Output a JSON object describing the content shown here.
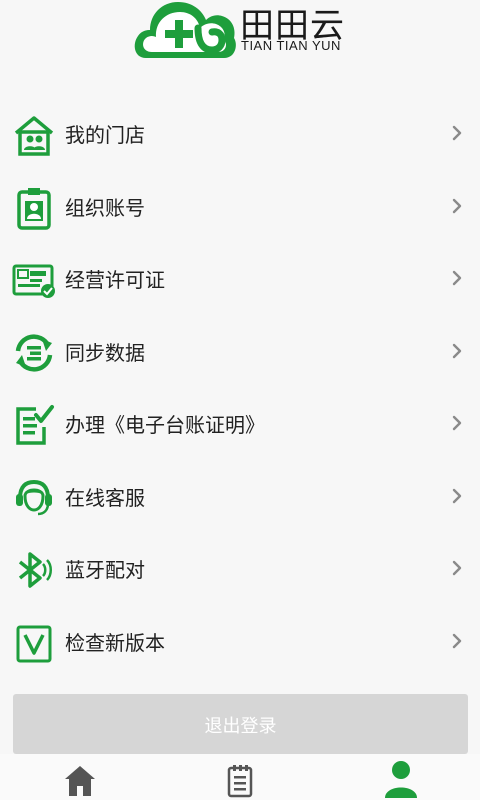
{
  "brand": {
    "name_cn": "田田云",
    "name_en": "TIAN TIAN YUN",
    "accent": "#1e9e3c"
  },
  "menu": {
    "items": [
      {
        "label": "我的门店",
        "icon": "store-icon"
      },
      {
        "label": "组织账号",
        "icon": "id-badge-icon"
      },
      {
        "label": "经营许可证",
        "icon": "license-icon"
      },
      {
        "label": "同步数据",
        "icon": "sync-icon"
      },
      {
        "label": "办理《电子台账证明》",
        "icon": "document-check-icon"
      },
      {
        "label": "在线客服",
        "icon": "headset-icon"
      },
      {
        "label": "蓝牙配对",
        "icon": "bluetooth-icon"
      },
      {
        "label": "检查新版本",
        "icon": "version-icon"
      }
    ]
  },
  "logout": {
    "label": "退出登录"
  },
  "tabbar": {
    "tabs": [
      {
        "icon": "home-icon",
        "active": false
      },
      {
        "icon": "notepad-icon",
        "active": false
      },
      {
        "icon": "user-icon",
        "active": true
      }
    ]
  }
}
